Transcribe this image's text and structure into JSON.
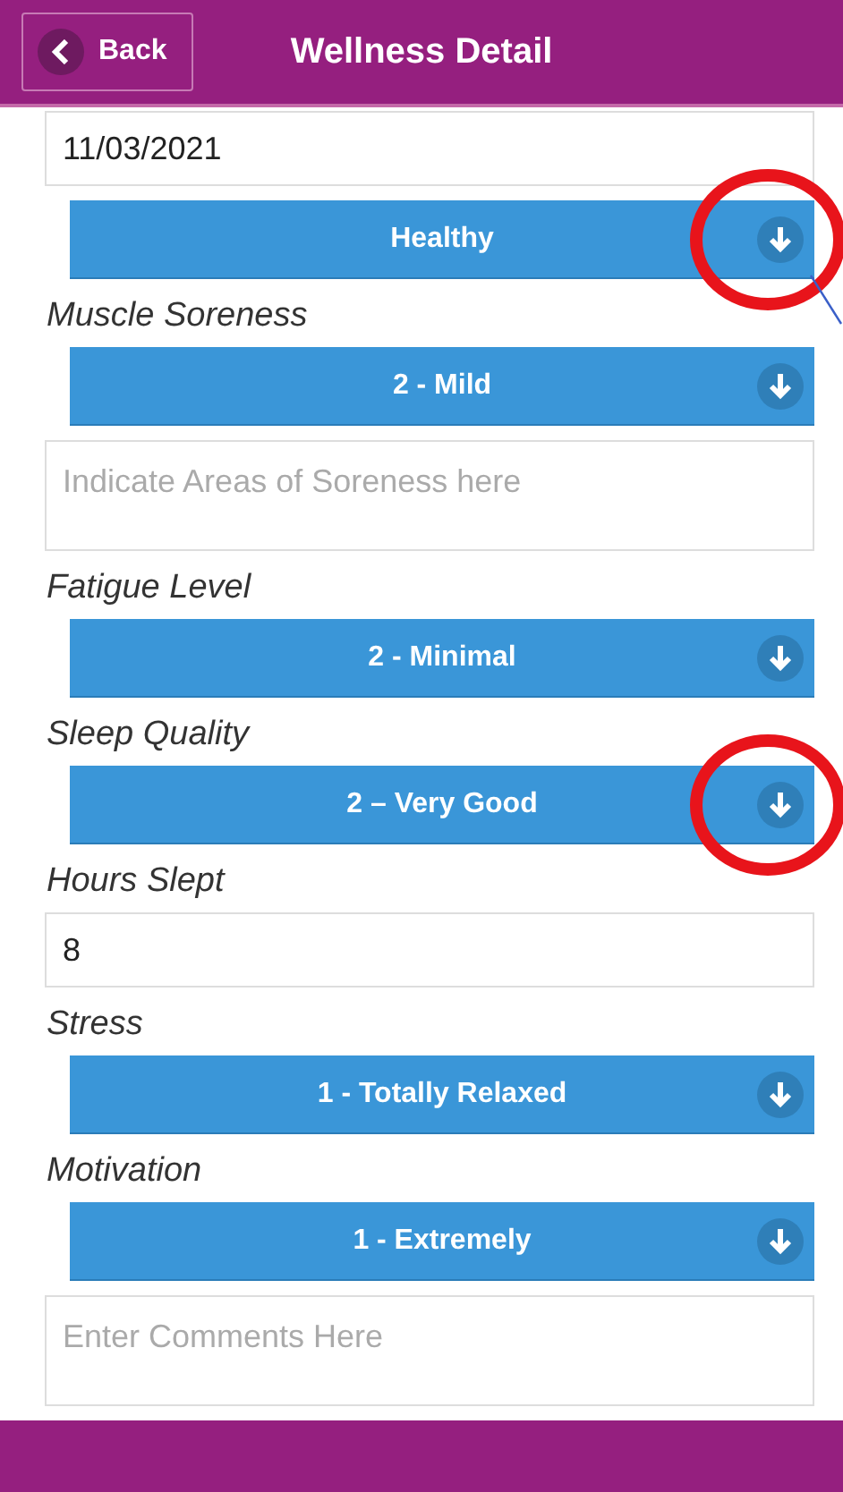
{
  "header": {
    "back": "Back",
    "title": "Wellness Detail"
  },
  "fields": [
    {
      "kind": "input",
      "value": "11/03/2021"
    },
    {
      "kind": "select",
      "value": "Healthy",
      "circled": true,
      "pointer_line": true
    },
    {
      "kind": "label",
      "text": "Muscle Soreness"
    },
    {
      "kind": "select",
      "value": "2 - Mild",
      "circled": false
    },
    {
      "kind": "textarea",
      "placeholder": "Indicate Areas of Soreness here"
    },
    {
      "kind": "label",
      "text": "Fatigue Level"
    },
    {
      "kind": "select",
      "value": "2 - Minimal",
      "circled": false
    },
    {
      "kind": "label",
      "text": "Sleep Quality"
    },
    {
      "kind": "select",
      "value": "2 – Very Good",
      "circled": true
    },
    {
      "kind": "label",
      "text": "Hours Slept"
    },
    {
      "kind": "input",
      "value": "8"
    },
    {
      "kind": "label",
      "text": "Stress"
    },
    {
      "kind": "select",
      "value": "1 - Totally Relaxed",
      "circled": false
    },
    {
      "kind": "label",
      "text": "Motivation"
    },
    {
      "kind": "select",
      "value": "1 - Extremely",
      "circled": false
    },
    {
      "kind": "textarea",
      "placeholder": "Enter Comments Here"
    }
  ]
}
